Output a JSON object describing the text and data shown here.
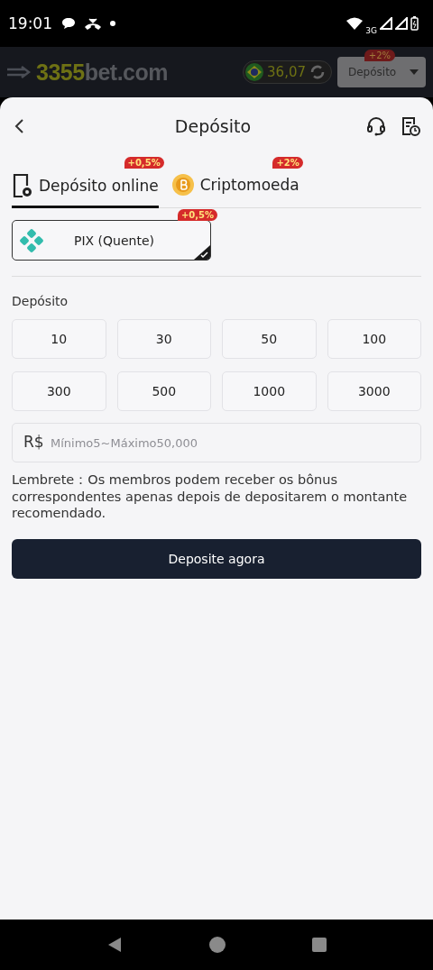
{
  "status_bar": {
    "time": "19:01",
    "network": "3G"
  },
  "app_header": {
    "logo": [
      "3355",
      "bet.com"
    ],
    "balance": "36,07",
    "deposit_button": {
      "label": "Depósito",
      "badge": "+2%"
    }
  },
  "sheet": {
    "title": "Depósito",
    "tabs": [
      {
        "label": "Depósito online",
        "badge": "+0,5%",
        "selected": true,
        "kind": "phone"
      },
      {
        "label": "Criptomoeda",
        "badge": "+2%",
        "selected": false,
        "kind": "coin"
      }
    ],
    "methods": [
      {
        "label": "PIX (Quente)",
        "badge": "+0,5%",
        "selected": true
      }
    ],
    "amount_label": "Depósito",
    "amounts": [
      {
        "label": "10",
        "selected": false
      },
      {
        "label": "30",
        "selected": false
      },
      {
        "label": "50",
        "selected": false
      },
      {
        "label": "100",
        "selected": false
      },
      {
        "label": "300",
        "selected": false
      },
      {
        "label": "500",
        "selected": false
      },
      {
        "label": "1000",
        "selected": false
      },
      {
        "label": "3000",
        "selected": false
      }
    ],
    "amount_field": {
      "currency": "R$",
      "placeholder": "Mínimo5~Máximo50,000"
    },
    "reminder": "Lembrete：Os membros podem receber os bônus correspondentes apenas depois de depositarem o montante recomendado.",
    "submit": "Deposite agora"
  }
}
